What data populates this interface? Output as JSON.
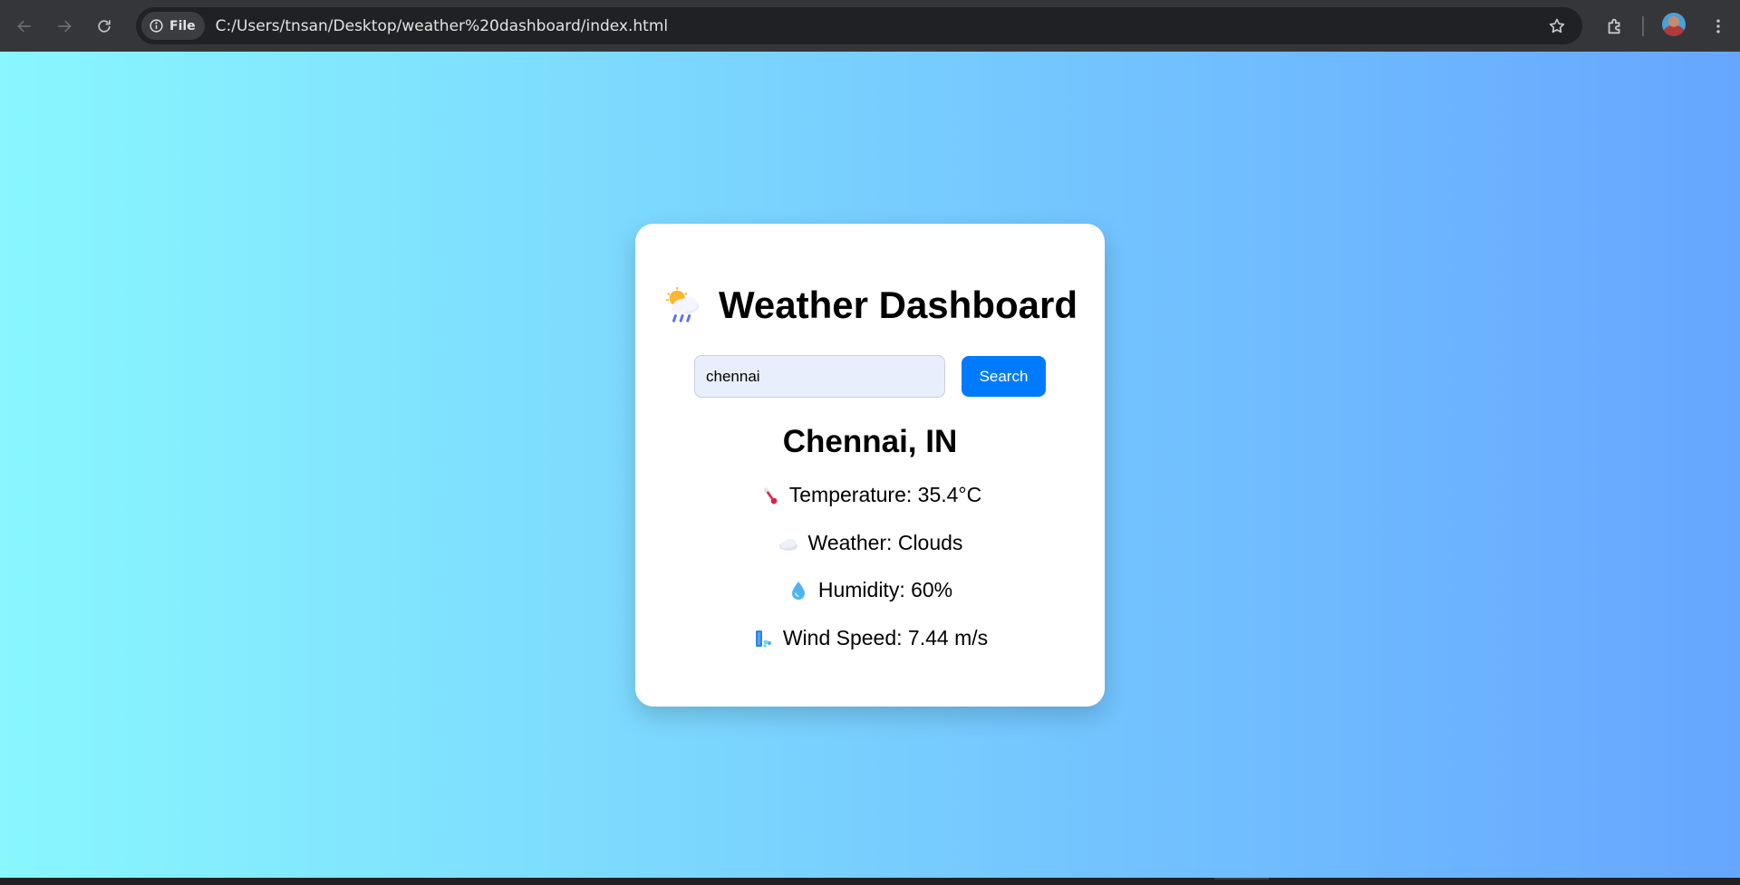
{
  "browser": {
    "site_chip_label": "File",
    "url": "C:/Users/tnsan/Desktop/weather%20dashboard/index.html"
  },
  "dashboard": {
    "title": "Weather Dashboard",
    "title_icon": "sun-behind-rain-cloud-icon",
    "search_value": "chennai",
    "search_button_label": "Search",
    "city": "Chennai, IN",
    "stats": {
      "temperature": "Temperature: 35.4°C",
      "weather": "Weather: Clouds",
      "humidity": "Humidity: 60%",
      "wind": "Wind Speed: 7.44 m/s"
    },
    "stat_icons": [
      "thermometer-icon",
      "cloud-icon",
      "droplet-icon",
      "wind-icon"
    ]
  },
  "colors": {
    "gradient_start": "#89f7fe",
    "gradient_end": "#66a6ff",
    "button": "#007bff",
    "input_bg": "#e8eefc"
  }
}
